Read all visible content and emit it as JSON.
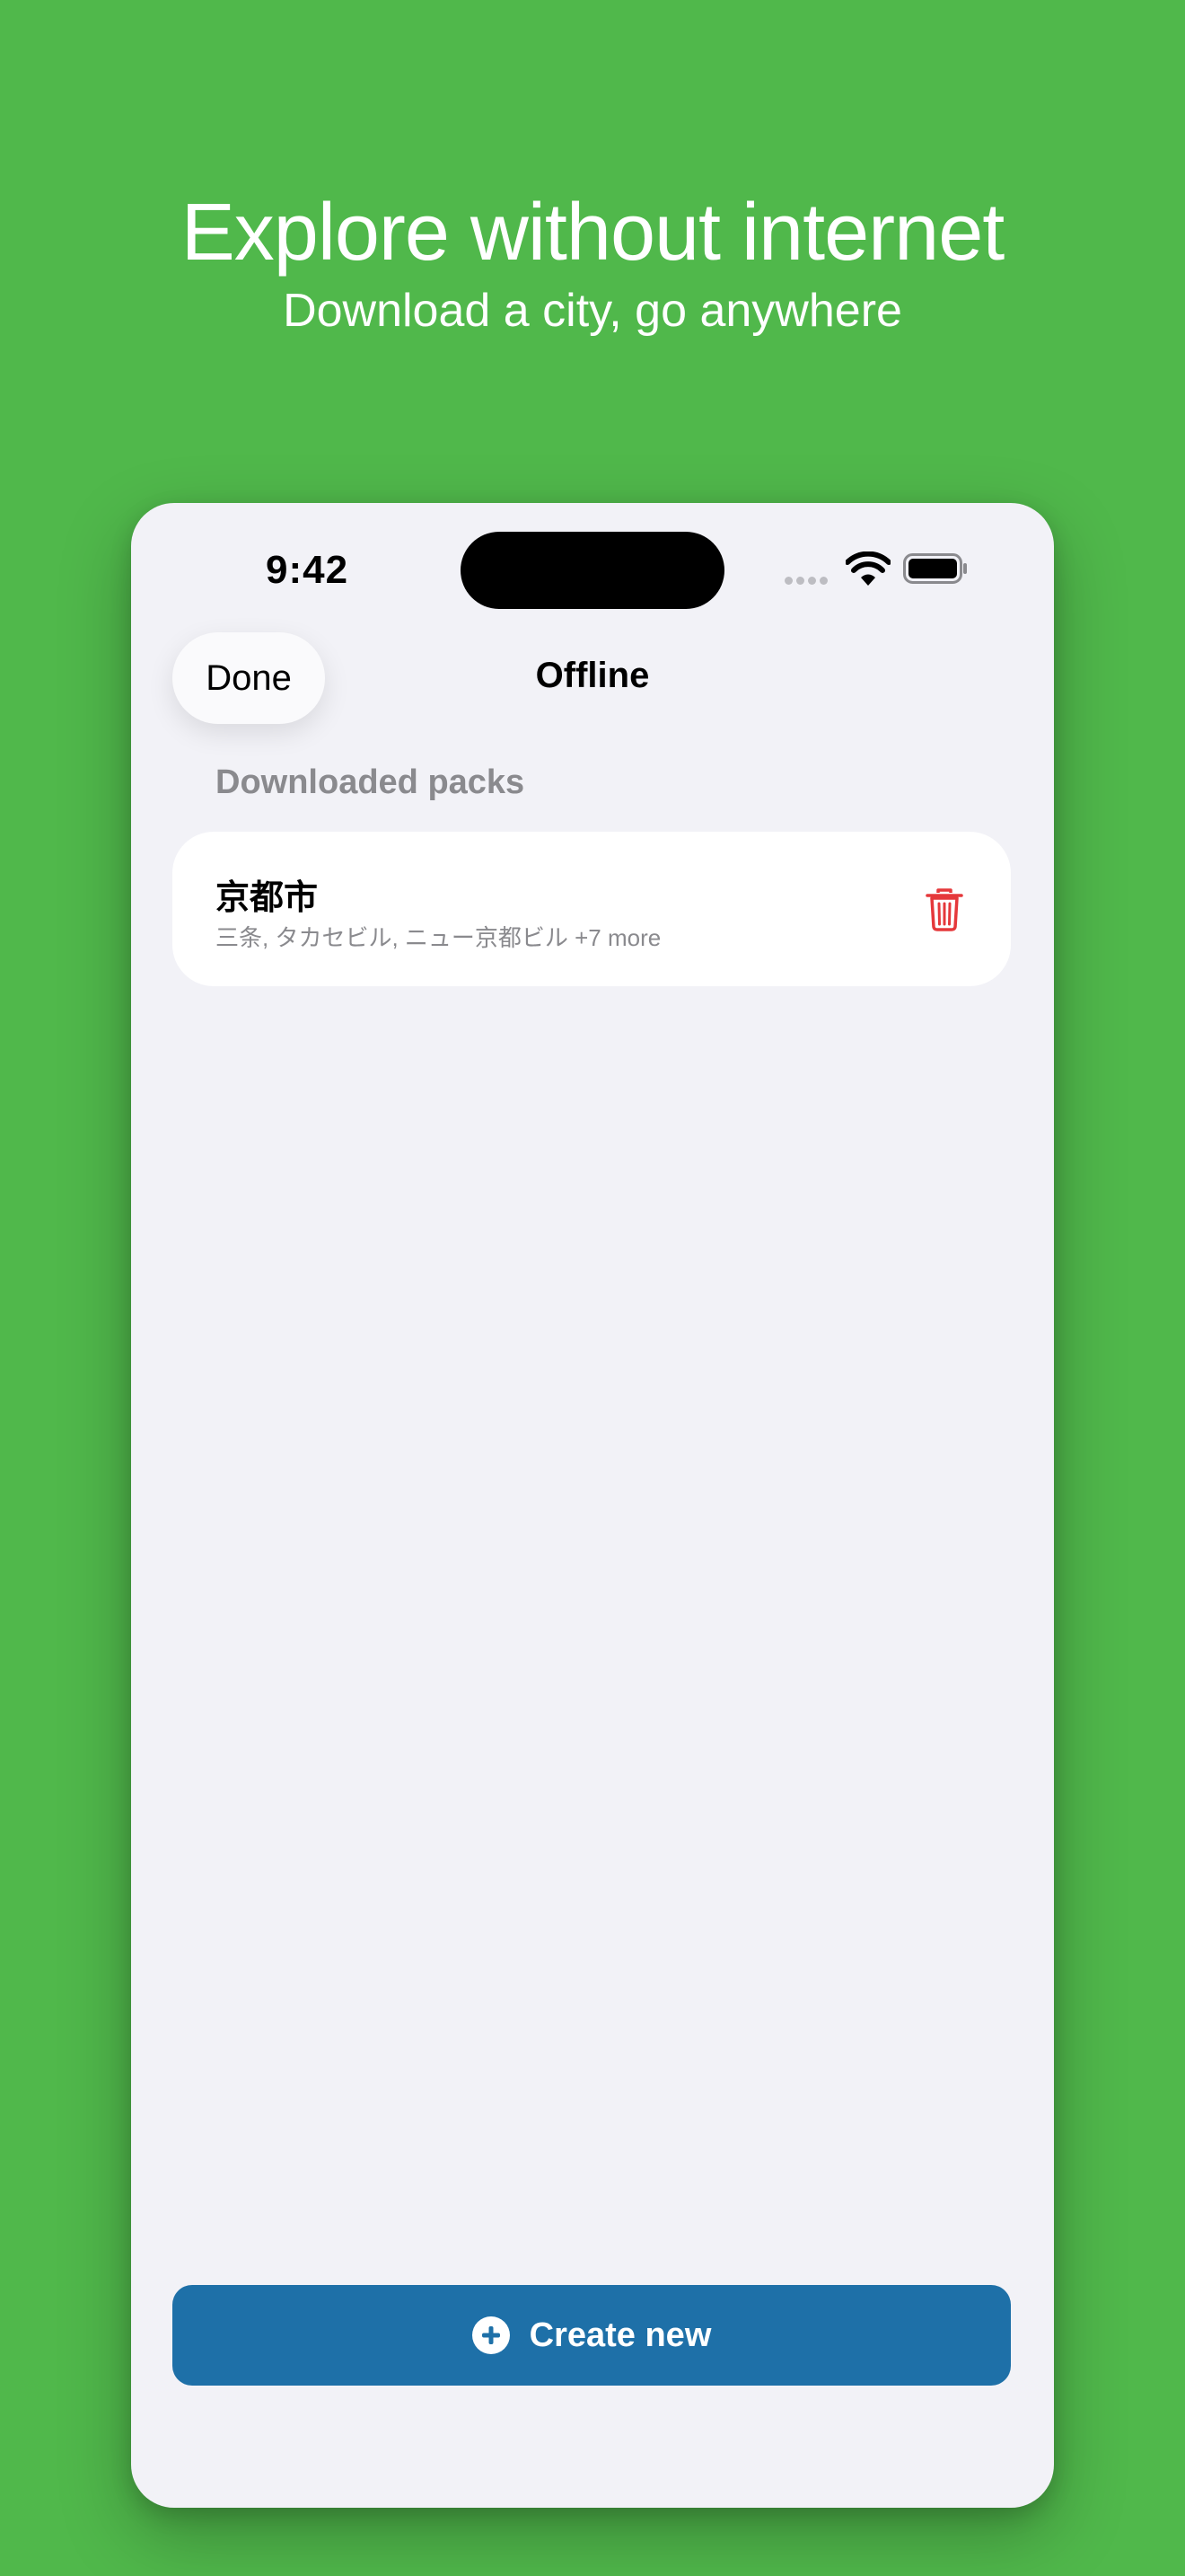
{
  "promo": {
    "title": "Explore without internet",
    "subtitle": "Download a city, go anywhere"
  },
  "status_bar": {
    "time": "9:42",
    "icons": [
      "cellular-signal-icon",
      "wifi-icon",
      "battery-icon"
    ]
  },
  "nav": {
    "done_label": "Done",
    "title": "Offline"
  },
  "downloaded": {
    "header": "Downloaded packs",
    "packs": [
      {
        "title": "京都市",
        "subtitle": "三条, タカセビル, ニュー京都ビル +7 more",
        "icon": "trash-icon"
      }
    ]
  },
  "footer": {
    "create_label": "Create new",
    "icon": "plus-circle-icon"
  },
  "colors": {
    "background": "#50B84B",
    "screen": "#F2F2F7",
    "accent": "#1E70A8",
    "destructive": "#E5383B",
    "secondary_text": "#8A8A8E"
  }
}
